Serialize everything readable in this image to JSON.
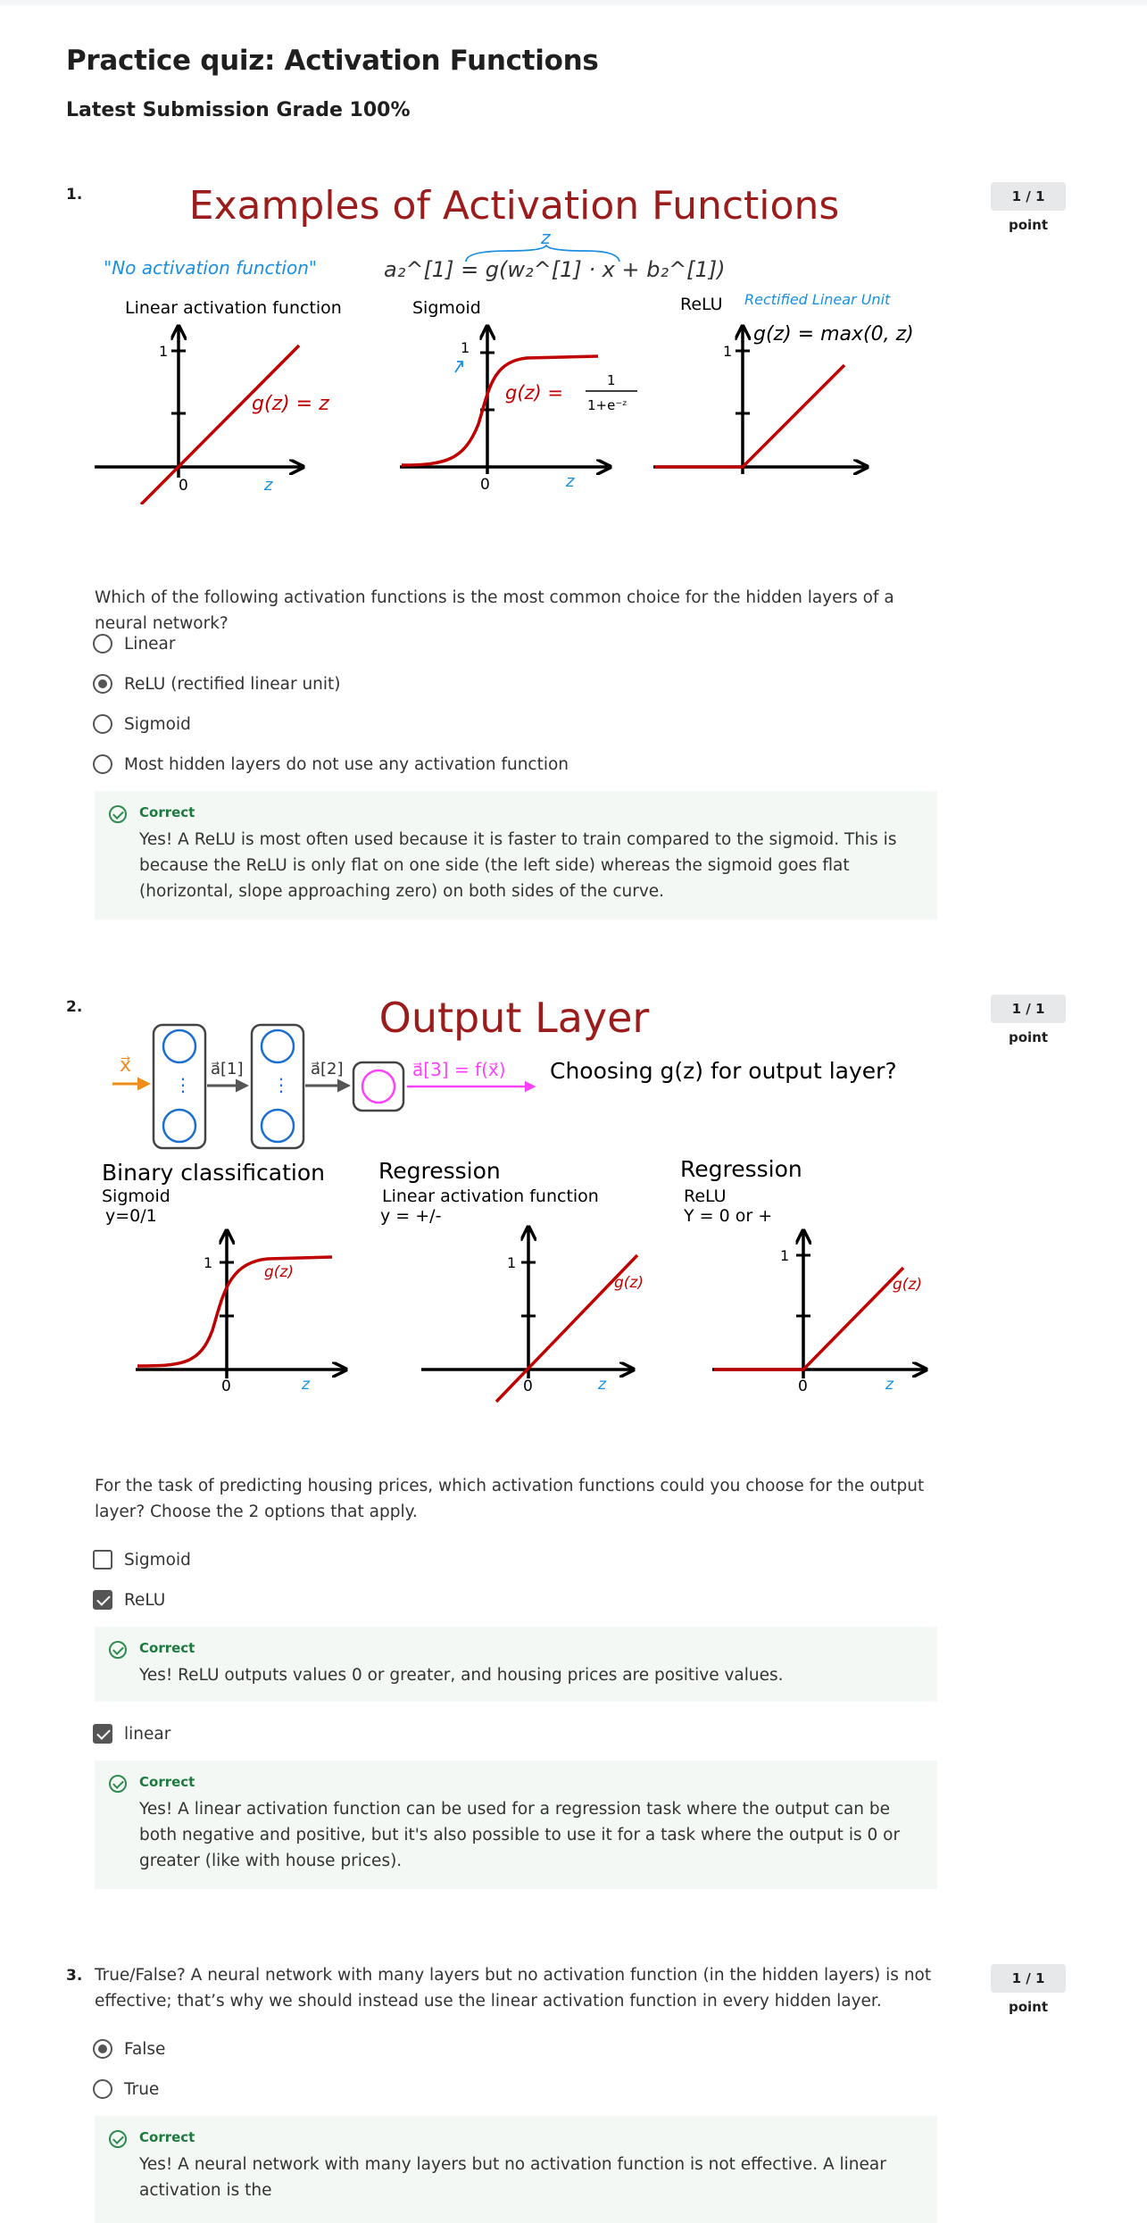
{
  "page": {
    "title": "Practice quiz: Activation Functions",
    "grade": "Latest Submission Grade 100%"
  },
  "colors": {
    "correct_green": "#1d7a3f",
    "feedback_bg": "#f3f8f4",
    "figure_red": "#c00000",
    "title_red": "#9c1c1c",
    "figure_blue": "#1a8fe0",
    "badge_bg": "#e6e8ea"
  },
  "icons": [
    "correct-check-icon",
    "radio-button",
    "checkbox"
  ],
  "questions": [
    {
      "number": "1.",
      "points": "1 / 1 point",
      "figure": {
        "title": "Examples of Activation Functions",
        "equation": "a₂^[1] = g(w₂^[1] · x + b₂^[1])",
        "z_brace": "z",
        "no_activation_note": "\"No activation function\"",
        "panels": [
          {
            "label": "Linear activation function",
            "formula": "g(z) = z",
            "one": "1",
            "zero": "0",
            "z": "z"
          },
          {
            "label": "Sigmoid",
            "formula": "g(z) =",
            "frac_num": "1",
            "frac_den": "1+e⁻ᶻ",
            "one": "1",
            "zero": "0",
            "z": "z"
          },
          {
            "label": "ReLU",
            "note": "Rectified Linear Unit",
            "formula": "g(z) = max(0, z)",
            "one": "1"
          }
        ]
      },
      "text": "Which of the following activation functions is the most common choice for the hidden layers of a neural network?",
      "options": [
        {
          "label": "Linear",
          "selected": false
        },
        {
          "label": "ReLU (rectified linear unit)",
          "selected": true
        },
        {
          "label": "Sigmoid",
          "selected": false
        },
        {
          "label": "Most hidden layers do not use any activation function",
          "selected": false
        }
      ],
      "feedback": {
        "label": "Correct",
        "message": "Yes! A ReLU is most often used because it is faster to train compared to the sigmoid. This is because the ReLU is only flat on one side (the left side) whereas the sigmoid goes flat (horizontal, slope approaching zero) on both sides of the curve."
      }
    },
    {
      "number": "2.",
      "points": "1 / 1 point",
      "figure": {
        "title": "Output Layer",
        "x_label": "x⃗",
        "a1": "a⃗[1]",
        "a2": "a⃗[2]",
        "a3_eq": "a⃗[3] = f(x⃗)",
        "question": "Choosing g(z) for output layer?",
        "panels": [
          {
            "heading": "Binary classification",
            "sub1": "Sigmoid",
            "sub2": "y=0/1",
            "one": "1",
            "zero": "0",
            "z": "z",
            "g": "g(z)"
          },
          {
            "heading": "Regression",
            "sub1": "Linear activation function",
            "sub2": "y = +/-",
            "one": "1",
            "zero": "0",
            "z": "z",
            "g": "g(z)"
          },
          {
            "heading": "Regression",
            "sub1": "ReLU",
            "sub2": "Y = 0 or +",
            "one": "1",
            "zero": "0",
            "z": "z",
            "g": "g(z)"
          }
        ]
      },
      "text": "For the task of predicting housing prices, which activation functions could you choose for the output layer? Choose the 2 options that apply.",
      "options": [
        {
          "label": "Sigmoid",
          "selected": false
        },
        {
          "label": "ReLU",
          "selected": true
        },
        {
          "label": "linear",
          "selected": true
        }
      ],
      "feedback_relu": {
        "label": "Correct",
        "message": "Yes! ReLU outputs values 0 or greater, and housing prices are positive values."
      },
      "feedback_linear": {
        "label": "Correct",
        "message": "Yes! A linear activation function can be used for a regression task where the output can be both negative and positive, but it's also possible to use it for a task where the output is 0 or greater (like with house prices)."
      }
    },
    {
      "number": "3.",
      "points": "1 / 1 point",
      "text": "True/False? A neural network with many layers but no activation function (in the hidden layers) is not effective; that’s why we should instead use the linear activation function in every hidden layer.",
      "options": [
        {
          "label": "False",
          "selected": true
        },
        {
          "label": "True",
          "selected": false
        }
      ],
      "feedback": {
        "label": "Correct",
        "message": "Yes! A neural network with many layers but no activation function is not effective. A linear activation is the"
      }
    }
  ]
}
